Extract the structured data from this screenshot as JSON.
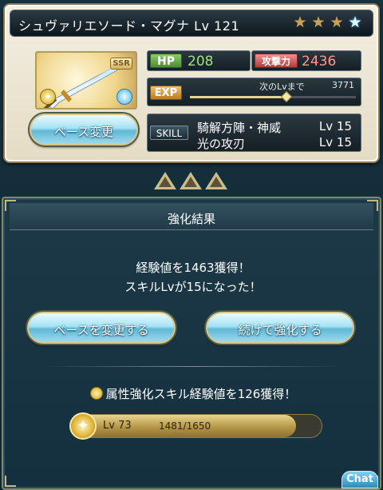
{
  "weapon": {
    "name": "シュヴァリエソード・マグナ",
    "level_label": "Lv 121",
    "rarity": "SSR",
    "stars": [
      "gold",
      "gold",
      "gold",
      "blue"
    ]
  },
  "stats": {
    "hp_label": "HP",
    "hp_value": "208",
    "atk_label": "攻撃力",
    "atk_value": "2436",
    "exp_label": "EXP",
    "exp_next_label": "次のLvまで",
    "exp_next_value": "3771",
    "exp_fraction": 0.58
  },
  "skills": {
    "label": "SKILL",
    "rows": [
      {
        "name": "騎解方陣・神威",
        "level": "Lv 15"
      },
      {
        "name": "光の攻刃",
        "level": "Lv 15"
      }
    ]
  },
  "buttons": {
    "change_base": "ベース変更",
    "change_base_2": "ベースを変更する",
    "continue_enhance": "続けて強化する"
  },
  "result": {
    "title": "強化結果",
    "line1": "経験値を1463獲得！",
    "line2": "スキルLvが15になった！",
    "attr_line": "属性強化スキル経験値を126獲得！",
    "attr_level": "Lv 73",
    "attr_exp": "1481/1650",
    "attr_fraction": 0.8976
  },
  "chat_label": "Chat",
  "colors": {
    "hp": "#9de37a",
    "atk": "#ff9a8a",
    "button_blue": "#61b7d6"
  }
}
